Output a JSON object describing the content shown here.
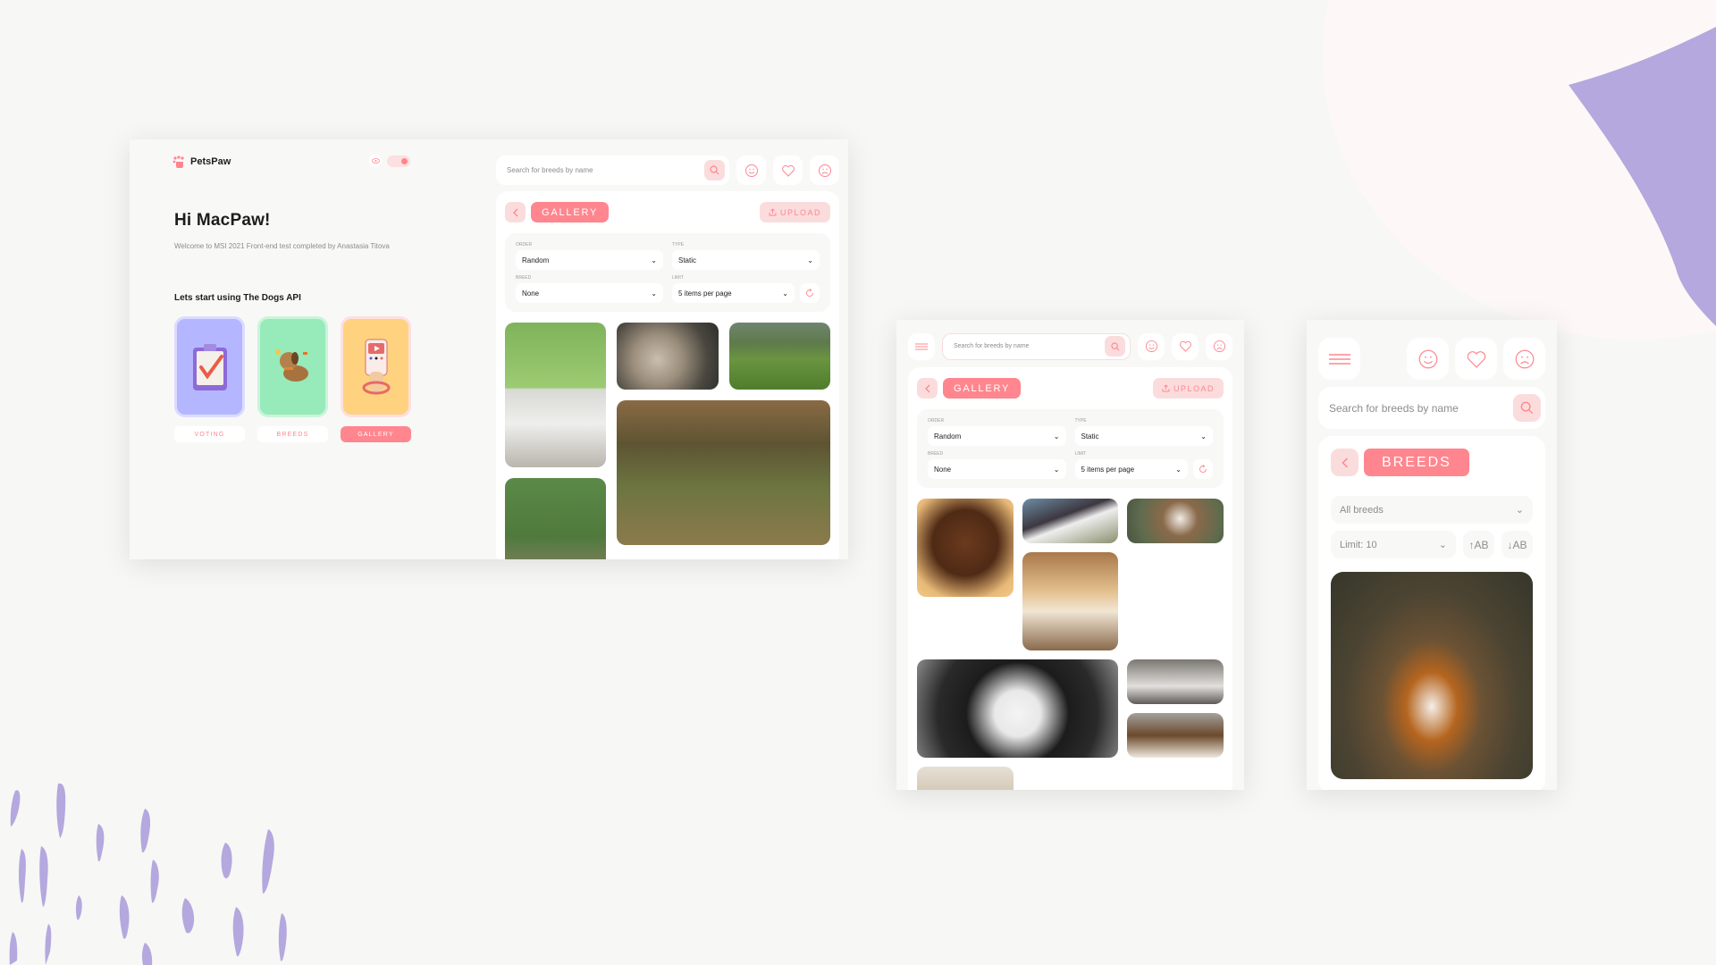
{
  "colors": {
    "accent": "#ff868e",
    "accent_light": "#fbdcdd",
    "background": "#f7f7f5",
    "panel": "#f8f8f7",
    "purple": "#b4a8de",
    "voting_card": "#b4b7ff",
    "breeds_card": "#97eab9",
    "gallery_card": "#ffd280"
  },
  "desktop": {
    "brand": "PetsPaw",
    "greeting": "Hi MacPaw!",
    "welcome": "Welcome to MSI 2021 Front-end test completed by Anastasia Titova",
    "cta": "Lets start using The Dogs API",
    "theme_toggle_on": true,
    "cards": [
      {
        "label": "VOTING",
        "icon": "clipboard-check-icon",
        "active": false
      },
      {
        "label": "BREEDS",
        "icon": "dog-icon",
        "active": false
      },
      {
        "label": "GALLERY",
        "icon": "phone-video-icon",
        "active": true
      }
    ],
    "search_placeholder": "Search for breeds by name",
    "section": "GALLERY",
    "upload": "UPLOAD",
    "filters": {
      "order_label": "ORDER",
      "order_value": "Random",
      "type_label": "TYPE",
      "type_value": "Static",
      "breed_label": "BREED",
      "breed_value": "None",
      "limit_label": "LIMIT",
      "limit_value": "5 items per page"
    },
    "photos": [
      "white bedlington terrier on road",
      "husky smiling",
      "white dog in field",
      "border collie on hill",
      "white dog in autumn forest"
    ]
  },
  "tablet": {
    "search_placeholder": "Search for breeds by name",
    "section": "GALLERY",
    "upload": "UPLOAD",
    "filters": {
      "order_label": "ORDER",
      "order_value": "Random",
      "type_label": "TYPE",
      "type_value": "Static",
      "breed_label": "BREED",
      "breed_value": "None",
      "limit_label": "LIMIT",
      "limit_value": "5 items per page"
    },
    "photos": [
      "brown puppy lying",
      "border collie on grass",
      "saint bernard puppy",
      "shiba inu",
      "border collie close-up",
      "pitbull",
      "beagle",
      "beige dog"
    ]
  },
  "mobile": {
    "search_placeholder": "Search for breeds by name",
    "section": "BREEDS",
    "breed_select": "All breeds",
    "limit_select": "Limit: 10",
    "sort_asc": "↑AB",
    "sort_desc": "↓AB",
    "photo": "brown and white spaniel in forest"
  }
}
